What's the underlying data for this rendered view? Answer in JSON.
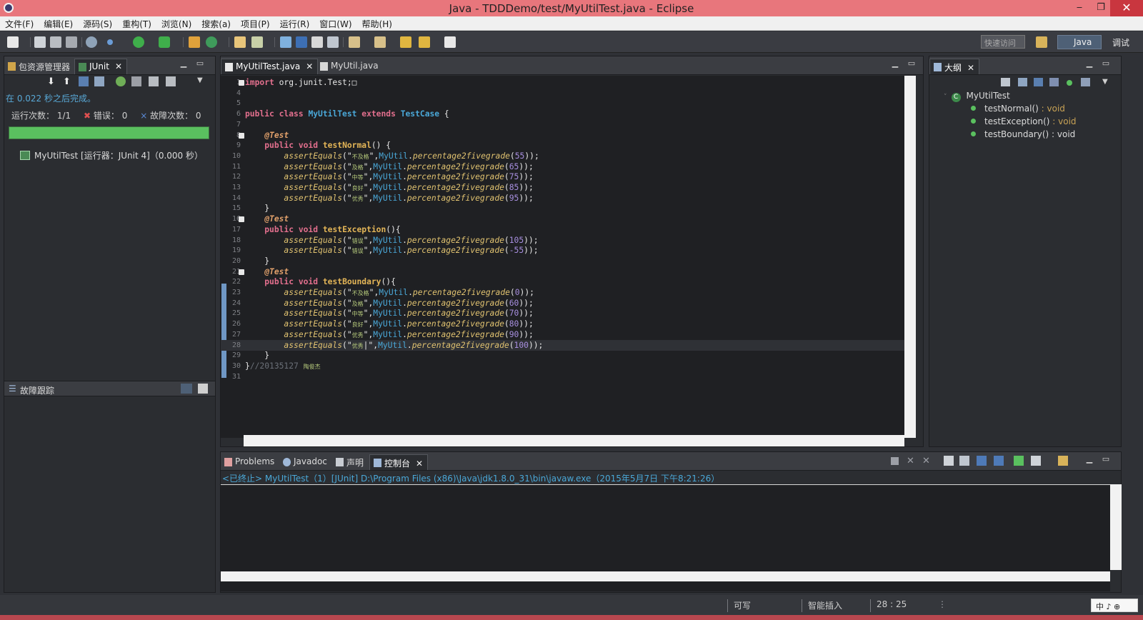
{
  "window": {
    "title": "Java - TDDDemo/test/MyUtilTest.java - Eclipse",
    "minimize": "‒",
    "restore": "❐",
    "close": "✕"
  },
  "menu": [
    "文件(F)",
    "编辑(E)",
    "源码(S)",
    "重构(T)",
    "浏览(N)",
    "搜索(a)",
    "项目(P)",
    "运行(R)",
    "窗口(W)",
    "帮助(H)"
  ],
  "toolbar": {
    "quick_access": "快速访问",
    "perspective_java": "Java",
    "perspective_debug": "调试"
  },
  "left_panel": {
    "tab_package_explorer": "包资源管理器",
    "tab_junit": "JUnit",
    "status": "在 0.022 秒之后完成。",
    "runs_label": "运行次数：",
    "runs_value": "1/1",
    "errors_label": "错误：",
    "errors_value": "0",
    "failures_label": "故障次数：",
    "failures_value": "0",
    "progress_percent": 100,
    "tree_item": "MyUtilTest [运行器：JUnit 4]（0.000 秒）",
    "failure_trace": "故障跟踪"
  },
  "editor": {
    "tabs": [
      {
        "label": "MyUtilTest.java",
        "active": true
      },
      {
        "label": "MyUtil.java",
        "active": false
      }
    ],
    "lines": [
      {
        "n": "1",
        "parts": [
          [
            "kw",
            "import"
          ],
          [
            "plain",
            " org.junit.Test;□"
          ]
        ],
        "fold": true
      },
      {
        "n": "4",
        "parts": []
      },
      {
        "n": "5",
        "parts": []
      },
      {
        "n": "6",
        "parts": [
          [
            "kw",
            "public class"
          ],
          [
            "plain",
            " "
          ],
          [
            "cls",
            "MyUtilTest"
          ],
          [
            "plain",
            " "
          ],
          [
            "kw",
            "extends"
          ],
          [
            "plain",
            " "
          ],
          [
            "cls",
            "TestCase"
          ],
          [
            "plain",
            " {"
          ]
        ]
      },
      {
        "n": "7",
        "parts": []
      },
      {
        "n": "8",
        "parts": [
          [
            "plain",
            "    "
          ],
          [
            "ann",
            "@Test"
          ]
        ],
        "fold": true
      },
      {
        "n": "9",
        "parts": [
          [
            "plain",
            "    "
          ],
          [
            "kw",
            "public void"
          ],
          [
            "plain",
            " "
          ],
          [
            "mdecl",
            "testNormal"
          ],
          [
            "plain",
            "() {"
          ]
        ]
      },
      {
        "n": "10",
        "parts": [
          [
            "plain",
            "        "
          ],
          [
            "meth",
            "assertEquals"
          ],
          [
            "plain",
            "(\""
          ],
          [
            "str",
            "不及格"
          ],
          [
            "plain",
            "\","
          ],
          [
            "field",
            "MyUtil"
          ],
          [
            "plain",
            "."
          ],
          [
            "meth",
            "percentage2fivegrade"
          ],
          [
            "plain",
            "("
          ],
          [
            "num",
            "55"
          ],
          [
            "plain",
            "));"
          ]
        ]
      },
      {
        "n": "11",
        "parts": [
          [
            "plain",
            "        "
          ],
          [
            "meth",
            "assertEquals"
          ],
          [
            "plain",
            "(\""
          ],
          [
            "str",
            "及格"
          ],
          [
            "plain",
            "\","
          ],
          [
            "field",
            "MyUtil"
          ],
          [
            "plain",
            "."
          ],
          [
            "meth",
            "percentage2fivegrade"
          ],
          [
            "plain",
            "("
          ],
          [
            "num",
            "65"
          ],
          [
            "plain",
            "));"
          ]
        ]
      },
      {
        "n": "12",
        "parts": [
          [
            "plain",
            "        "
          ],
          [
            "meth",
            "assertEquals"
          ],
          [
            "plain",
            "(\""
          ],
          [
            "str",
            "中等"
          ],
          [
            "plain",
            "\","
          ],
          [
            "field",
            "MyUtil"
          ],
          [
            "plain",
            "."
          ],
          [
            "meth",
            "percentage2fivegrade"
          ],
          [
            "plain",
            "("
          ],
          [
            "num",
            "75"
          ],
          [
            "plain",
            "));"
          ]
        ]
      },
      {
        "n": "13",
        "parts": [
          [
            "plain",
            "        "
          ],
          [
            "meth",
            "assertEquals"
          ],
          [
            "plain",
            "(\""
          ],
          [
            "str",
            "良好"
          ],
          [
            "plain",
            "\","
          ],
          [
            "field",
            "MyUtil"
          ],
          [
            "plain",
            "."
          ],
          [
            "meth",
            "percentage2fivegrade"
          ],
          [
            "plain",
            "("
          ],
          [
            "num",
            "85"
          ],
          [
            "plain",
            "));"
          ]
        ]
      },
      {
        "n": "14",
        "parts": [
          [
            "plain",
            "        "
          ],
          [
            "meth",
            "assertEquals"
          ],
          [
            "plain",
            "(\""
          ],
          [
            "str",
            "优秀"
          ],
          [
            "plain",
            "\","
          ],
          [
            "field",
            "MyUtil"
          ],
          [
            "plain",
            "."
          ],
          [
            "meth",
            "percentage2fivegrade"
          ],
          [
            "plain",
            "("
          ],
          [
            "num",
            "95"
          ],
          [
            "plain",
            "));"
          ]
        ]
      },
      {
        "n": "15",
        "parts": [
          [
            "plain",
            "    }"
          ]
        ]
      },
      {
        "n": "16",
        "parts": [
          [
            "plain",
            "    "
          ],
          [
            "ann",
            "@Test"
          ]
        ],
        "fold": true
      },
      {
        "n": "17",
        "parts": [
          [
            "plain",
            "    "
          ],
          [
            "kw",
            "public void"
          ],
          [
            "plain",
            " "
          ],
          [
            "mdecl",
            "testException"
          ],
          [
            "plain",
            "(){"
          ]
        ]
      },
      {
        "n": "18",
        "parts": [
          [
            "plain",
            "        "
          ],
          [
            "meth",
            "assertEquals"
          ],
          [
            "plain",
            "(\""
          ],
          [
            "str",
            "错误"
          ],
          [
            "plain",
            "\","
          ],
          [
            "field",
            "MyUtil"
          ],
          [
            "plain",
            "."
          ],
          [
            "meth",
            "percentage2fivegrade"
          ],
          [
            "plain",
            "("
          ],
          [
            "num",
            "105"
          ],
          [
            "plain",
            "));"
          ]
        ]
      },
      {
        "n": "19",
        "parts": [
          [
            "plain",
            "        "
          ],
          [
            "meth",
            "assertEquals"
          ],
          [
            "plain",
            "(\""
          ],
          [
            "str",
            "错误"
          ],
          [
            "plain",
            "\","
          ],
          [
            "field",
            "MyUtil"
          ],
          [
            "plain",
            "."
          ],
          [
            "meth",
            "percentage2fivegrade"
          ],
          [
            "plain",
            "("
          ],
          [
            "num",
            "-55"
          ],
          [
            "plain",
            "));"
          ]
        ]
      },
      {
        "n": "20",
        "parts": [
          [
            "plain",
            "    }"
          ]
        ]
      },
      {
        "n": "21",
        "parts": [
          [
            "plain",
            "    "
          ],
          [
            "ann",
            "@Test"
          ]
        ],
        "fold": true
      },
      {
        "n": "22",
        "parts": [
          [
            "plain",
            "    "
          ],
          [
            "kw",
            "public void"
          ],
          [
            "plain",
            " "
          ],
          [
            "mdecl",
            "testBoundary"
          ],
          [
            "plain",
            "(){"
          ]
        ]
      },
      {
        "n": "23",
        "parts": [
          [
            "plain",
            "        "
          ],
          [
            "meth",
            "assertEquals"
          ],
          [
            "plain",
            "(\""
          ],
          [
            "str",
            "不及格"
          ],
          [
            "plain",
            "\","
          ],
          [
            "field",
            "MyUtil"
          ],
          [
            "plain",
            "."
          ],
          [
            "meth",
            "percentage2fivegrade"
          ],
          [
            "plain",
            "("
          ],
          [
            "num",
            "0"
          ],
          [
            "plain",
            "));"
          ]
        ]
      },
      {
        "n": "24",
        "parts": [
          [
            "plain",
            "        "
          ],
          [
            "meth",
            "assertEquals"
          ],
          [
            "plain",
            "(\""
          ],
          [
            "str",
            "及格"
          ],
          [
            "plain",
            "\","
          ],
          [
            "field",
            "MyUtil"
          ],
          [
            "plain",
            "."
          ],
          [
            "meth",
            "percentage2fivegrade"
          ],
          [
            "plain",
            "("
          ],
          [
            "num",
            "60"
          ],
          [
            "plain",
            "));"
          ]
        ]
      },
      {
        "n": "25",
        "parts": [
          [
            "plain",
            "        "
          ],
          [
            "meth",
            "assertEquals"
          ],
          [
            "plain",
            "(\""
          ],
          [
            "str",
            "中等"
          ],
          [
            "plain",
            "\","
          ],
          [
            "field",
            "MyUtil"
          ],
          [
            "plain",
            "."
          ],
          [
            "meth",
            "percentage2fivegrade"
          ],
          [
            "plain",
            "("
          ],
          [
            "num",
            "70"
          ],
          [
            "plain",
            "));"
          ]
        ]
      },
      {
        "n": "26",
        "parts": [
          [
            "plain",
            "        "
          ],
          [
            "meth",
            "assertEquals"
          ],
          [
            "plain",
            "(\""
          ],
          [
            "str",
            "良好"
          ],
          [
            "plain",
            "\","
          ],
          [
            "field",
            "MyUtil"
          ],
          [
            "plain",
            "."
          ],
          [
            "meth",
            "percentage2fivegrade"
          ],
          [
            "plain",
            "("
          ],
          [
            "num",
            "80"
          ],
          [
            "plain",
            "));"
          ]
        ]
      },
      {
        "n": "27",
        "parts": [
          [
            "plain",
            "        "
          ],
          [
            "meth",
            "assertEquals"
          ],
          [
            "plain",
            "(\""
          ],
          [
            "str",
            "优秀"
          ],
          [
            "plain",
            "\","
          ],
          [
            "field",
            "MyUtil"
          ],
          [
            "plain",
            "."
          ],
          [
            "meth",
            "percentage2fivegrade"
          ],
          [
            "plain",
            "("
          ],
          [
            "num",
            "90"
          ],
          [
            "plain",
            "));"
          ]
        ]
      },
      {
        "n": "28",
        "parts": [
          [
            "plain",
            "        "
          ],
          [
            "meth",
            "assertEquals"
          ],
          [
            "plain",
            "(\""
          ],
          [
            "str",
            "优秀"
          ],
          [
            "plain",
            "|\","
          ],
          [
            "field",
            "MyUtil"
          ],
          [
            "plain",
            "."
          ],
          [
            "meth",
            "percentage2fivegrade"
          ],
          [
            "plain",
            "("
          ],
          [
            "num",
            "100"
          ],
          [
            "plain",
            "));"
          ]
        ],
        "current": true
      },
      {
        "n": "29",
        "parts": [
          [
            "plain",
            "    }"
          ]
        ]
      },
      {
        "n": "30",
        "parts": [
          [
            "plain",
            "}"
          ],
          [
            "cmt",
            "//20135127 "
          ],
          [
            "str",
            "陶俊杰"
          ]
        ]
      },
      {
        "n": "31",
        "parts": []
      }
    ]
  },
  "outline": {
    "tab": "大纲",
    "class_name": "MyUtilTest",
    "class_icon": "C",
    "methods": [
      {
        "name": "testNormal()",
        "ret": " : void"
      },
      {
        "name": "testException()",
        "ret": " : void"
      },
      {
        "name": "testBoundary()",
        "ret": " : void"
      }
    ]
  },
  "console": {
    "tabs": [
      "Problems",
      "Javadoc",
      "声明",
      "控制台"
    ],
    "active_tab": "控制台",
    "header": "<已终止> MyUtilTest（1）[JUnit] D:\\Program Files (x86)\\Java\\jdk1.8.0_31\\bin\\javaw.exe（2015年5月7日 下午8:21:26）"
  },
  "status_bar": {
    "writable": "可写",
    "insert_mode": "智能插入",
    "position": "28 : 25",
    "ime": "中 ♪ ⊕"
  },
  "colors": {
    "title_bar": "#e8767c",
    "progress": "#5ac05f",
    "keyword": "#e26f8d",
    "class": "#4aa8d8"
  }
}
